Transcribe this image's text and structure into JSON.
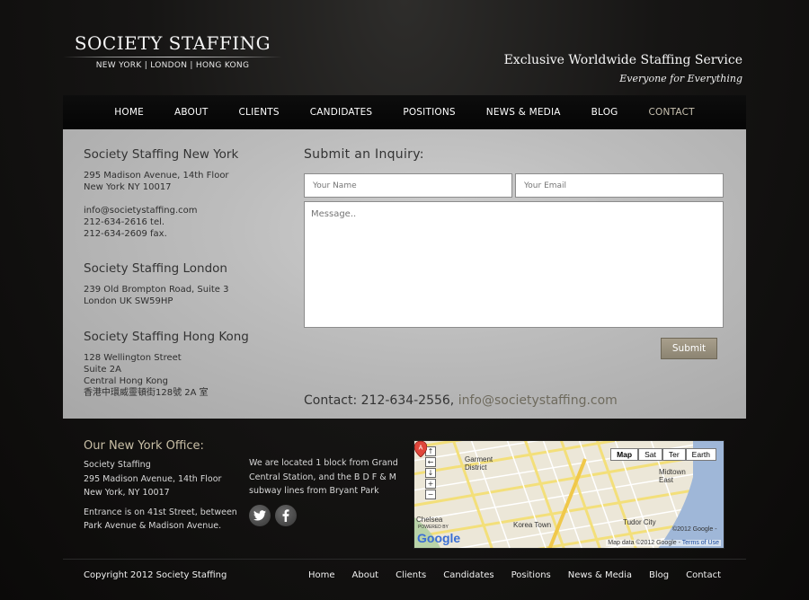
{
  "header": {
    "logo_title": "SOCIETY STAFFING",
    "logo_subtitle": "NEW YORK | LONDON | HONG KONG",
    "tagline": "Exclusive Worldwide Staffing Service",
    "tagline_sub": "Everyone for Everything"
  },
  "nav": {
    "items": [
      "HOME",
      "ABOUT",
      "CLIENTS",
      "CANDIDATES",
      "POSITIONS",
      "NEWS & MEDIA",
      "BLOG",
      "CONTACT"
    ],
    "active": "CONTACT"
  },
  "offices": {
    "new_york": {
      "title": "Society Staffing New York",
      "address1": "295 Madison Avenue, 14th Floor",
      "address2": "New York NY 10017",
      "email": "info@societystaffing.com",
      "tel": "212-634-2616 tel.",
      "fax": "212-634-2609 fax."
    },
    "london": {
      "title": "Society Staffing London",
      "address1": "239 Old Brompton Road, Suite 3",
      "address2": "London UK SW59HP"
    },
    "hong_kong": {
      "title": "Society Staffing Hong Kong",
      "address1": "128 Wellington Street",
      "address2": "Suite 2A",
      "address3": "Central Hong Kong",
      "address4": "香港中環威靈頓街128號 2A 室"
    }
  },
  "inquiry": {
    "title": "Submit an Inquiry:",
    "name_placeholder": "Your Name",
    "email_placeholder": "Your Email",
    "message_placeholder": "Message..",
    "submit_label": "Submit",
    "contact_prefix": "Contact: 212-634-2556,",
    "contact_email": "info@societystaffing.com"
  },
  "footer": {
    "office_title": "Our New York Office:",
    "office_line1": "Society Staffing",
    "office_line2": "295 Madison Avenue, 14th Floor",
    "office_line3": "New York, NY 10017",
    "entrance1": "Entrance is on 41st Street, between",
    "entrance2": "Park Avenue & Madison Avenue.",
    "located1": "We are located 1 block from Grand",
    "located2": "Central Station, and the B D F & M",
    "located3": "subway lines from Bryant Park",
    "copyright": "Copyright 2012 Society Staffing",
    "nav": [
      "Home",
      "About",
      "Clients",
      "Candidates",
      "Positions",
      "News & Media",
      "Blog",
      "Contact"
    ]
  },
  "map": {
    "types": [
      "Map",
      "Sat",
      "Ter",
      "Earth"
    ],
    "selected_type": "Map",
    "labels": [
      "Garment District",
      "Midtown East",
      "Chelsea",
      "Korea Town",
      "Tudor City"
    ],
    "copyright_corner": "©2012 Google -",
    "copyright": "Map data ©2012 Google -",
    "terms": "Terms of Use",
    "pin_letter": "A",
    "logo": "Google",
    "powered_by": "POWERED BY"
  },
  "colors": {
    "accent": "#c9bfa6",
    "button": "#9a917e",
    "panel": "#bdbdbd"
  }
}
